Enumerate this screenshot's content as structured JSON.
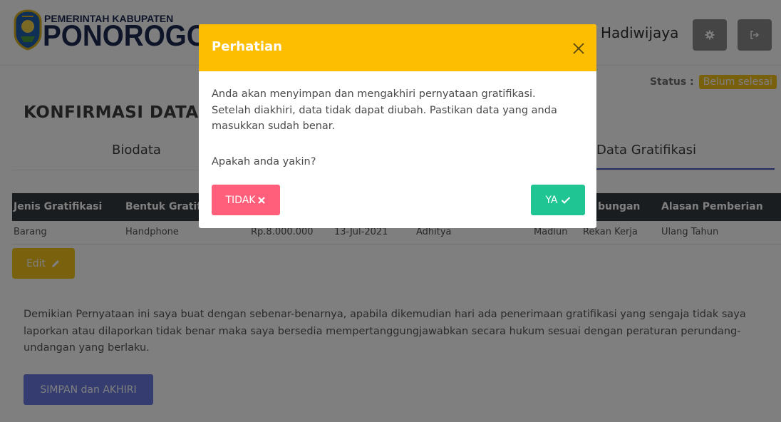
{
  "header": {
    "brand_line1": "PEMERINTAH KABUPATEN",
    "brand_line2": "PONOROGO",
    "user_name": "Hadiwijaya",
    "settings_icon": "gear-icon",
    "logout_icon": "logout-icon"
  },
  "status": {
    "label": "Status :",
    "value": "Belum selesai",
    "color": "#f0c11a"
  },
  "page": {
    "title": "KONFIRMASI DATA",
    "tabs": [
      {
        "label": "Biodata"
      },
      {
        "label": "Data Gratifikasi",
        "active": true
      }
    ]
  },
  "table": {
    "columns": [
      "Jenis Gratifikasi",
      "Bentuk Gratif",
      "bungan",
      "Alasan Pemberian"
    ],
    "rows": [
      [
        "Barang",
        "Handphone",
        "Rp.8.000.000",
        "13-Jul-2021",
        "Adhitya",
        "Madiun",
        "Rekan Kerja",
        "Ulang Tahun"
      ]
    ]
  },
  "edit_button": {
    "label": "Edit",
    "icon": "pencil-icon"
  },
  "declaration": "Demikian Pernyataan ini saya buat dengan sebenar-benarnya, apabila dikemudian hari ada penerimaan gratifikasi yang sengaja tidak saya laporkan atau dilaporkan tidak benar maka saya bersedia mempertanggungjawabkan secara hukum sesuai dengan peraturan perundang-undangan yang berlaku.",
  "save_end_button": {
    "label": "SIMPAN dan AKHIRI"
  },
  "modal": {
    "title": "Perhatian",
    "close_icon": "close-icon",
    "message": "Anda akan menyimpan dan mengakhiri pernyataan gratifikasi. Setelah diakhiri, data tidak dapat diubah. Pastikan data yang anda masukkan sudah benar.",
    "question": "Apakah anda yakin?",
    "no_label": "TIDAK",
    "yes_label": "YA",
    "header_color": "#fdbd00",
    "no_color": "#ff5f7a",
    "yes_color": "#1fc694"
  }
}
